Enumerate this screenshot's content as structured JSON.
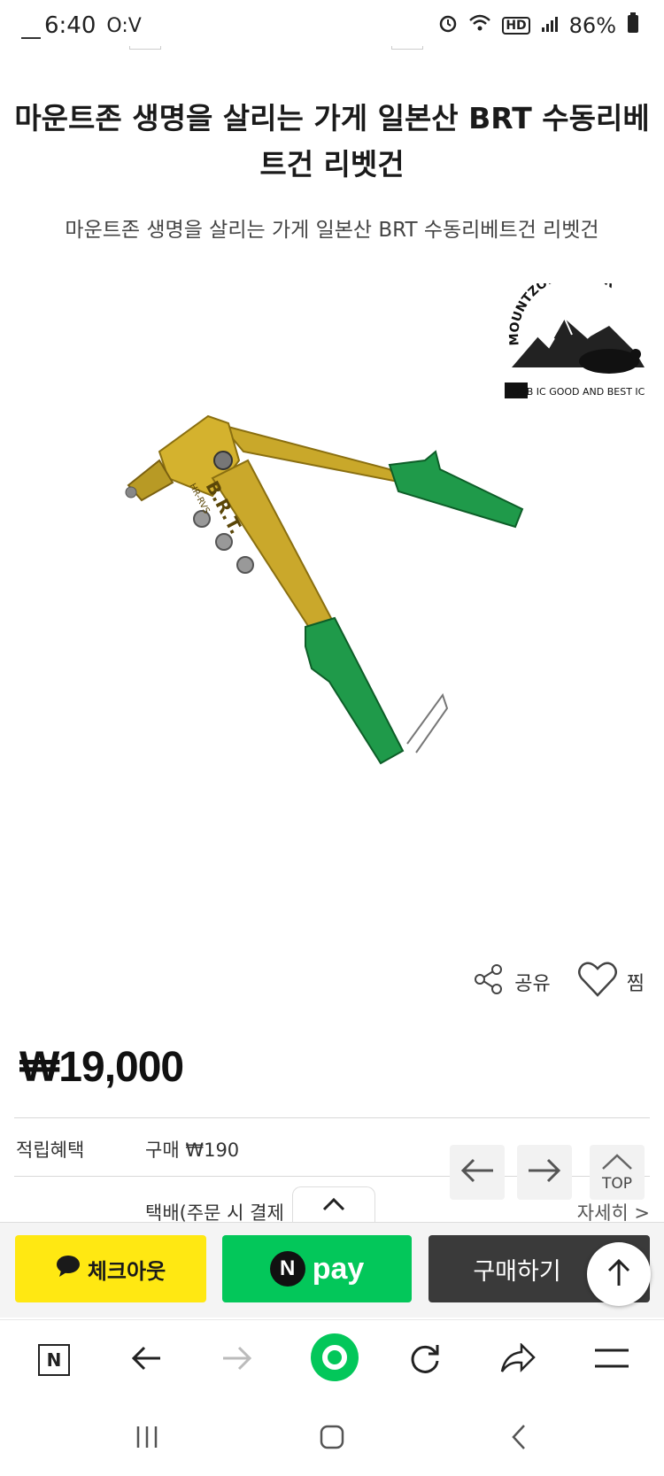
{
  "status_bar": {
    "time": "6:40",
    "left_icons": "O:V",
    "battery": "86%",
    "network": "HD"
  },
  "product": {
    "title": "마운트존 생명을 살리는 가게 일본산 BRT 수동리베트건 리벳건",
    "subtitle": "마운트존 생명을 살리는 가게 일본산 BRT 수동리베트건 리벳건",
    "image_text": "B.R.T.",
    "image_text_small": "HR-RVS",
    "logo_text_top": "MOUNTZONE.CO.KR",
    "logo_text_bottom": "G&B IC GOOD AND BEST IC"
  },
  "actions": {
    "share_label": "공유",
    "wish_label": "찜"
  },
  "price": "₩19,000",
  "points": {
    "label": "적립혜택",
    "value": "구매 ₩190"
  },
  "shipping": {
    "text": "택배(주문 시 결제",
    "detail_link": "자세히 >"
  },
  "float_controls": {
    "top_label": "TOP"
  },
  "buy_bar": {
    "checkout_label": "체크아웃",
    "npay_badge": "N",
    "npay_label": "pay",
    "purchase_label": "구매하기"
  },
  "browser_nav": {
    "home_label": "N"
  },
  "colors": {
    "checkout_yellow": "#ffe812",
    "naver_green": "#03c75a",
    "purchase_dark": "#3a3a3a"
  }
}
